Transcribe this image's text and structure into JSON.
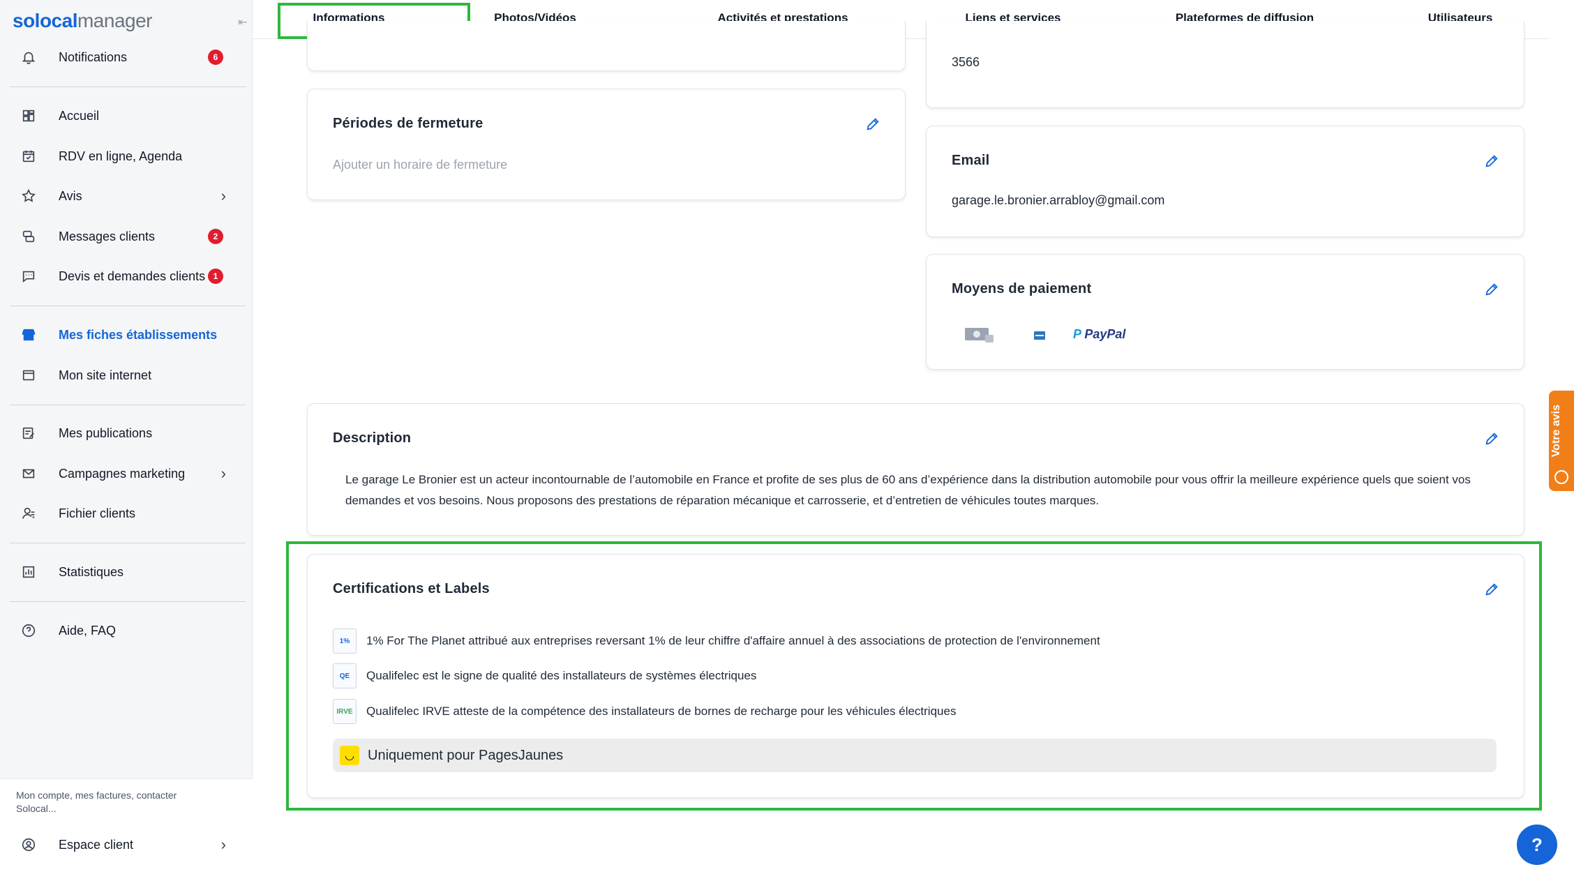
{
  "brand": {
    "logo_part1": "solocal",
    "logo_part2": "manager"
  },
  "sidebar": {
    "items": [
      {
        "label": "Notifications",
        "icon": "bell-icon",
        "badge": "6"
      },
      {
        "label": "Accueil",
        "icon": "dashboard-icon"
      },
      {
        "label": "RDV en ligne, Agenda",
        "icon": "calendar-icon"
      },
      {
        "label": "Avis",
        "icon": "star-icon"
      },
      {
        "label": "Messages clients",
        "icon": "messages-icon",
        "badge": "2"
      },
      {
        "label": "Devis et demandes clients",
        "icon": "chat-icon",
        "badge": "1"
      },
      {
        "label": "Mes fiches établissements",
        "icon": "store-icon"
      },
      {
        "label": "Mon site internet",
        "icon": "browser-icon"
      },
      {
        "label": "Mes publications",
        "icon": "publication-icon"
      },
      {
        "label": "Campagnes marketing",
        "icon": "mail-icon"
      },
      {
        "label": "Fichier clients",
        "icon": "users-icon"
      },
      {
        "label": "Statistiques",
        "icon": "stats-icon"
      },
      {
        "label": "Aide, FAQ",
        "icon": "help-icon"
      }
    ],
    "account_note": "Mon compte, mes factures, contacter Solocal...",
    "espace_client": "Espace client"
  },
  "tabs": [
    "Informations",
    "Photos/Vidéos",
    "Activités et prestations",
    "Liens et services",
    "Plateformes de diffusion",
    "Utilisateurs"
  ],
  "cards": {
    "top_right_value": "3566",
    "fermeture": {
      "title": "Périodes de fermeture",
      "placeholder": "Ajouter un horaire de fermeture"
    },
    "email": {
      "title": "Email",
      "value": "garage.le.bronier.arrabloy@gmail.com"
    },
    "paiement": {
      "title": "Moyens de paiement",
      "methods": [
        "cash-icon",
        "amex-icon"
      ],
      "paypal": "PayPal"
    },
    "description": {
      "title": "Description",
      "text": "Le garage Le Bronier est un acteur incontournable de l’automobile en France et profite de ses plus de 60 ans d’expérience dans la distribution automobile pour vous offrir la meilleure expérience quels que soient vos demandes et vos besoins. Nous proposons des prestations de réparation mécanique et carrosserie, et d’entretien de véhicules toutes marques."
    },
    "certifications": {
      "title": "Certifications et Labels",
      "items": [
        {
          "text": "1% For The Planet attribué aux entreprises reversant 1% de leur chiffre d'affaire annuel à des associations de protection de l'environnement",
          "logo": "1%"
        },
        {
          "text": "Qualifelec est le signe de qualité des installateurs de systèmes électriques",
          "logo": "QE"
        },
        {
          "text": "Qualifelec IRVE atteste de la compétence des installateurs de bornes de recharge pour les véhicules électriques",
          "logo": "IRVE"
        }
      ],
      "pagesjaunes": "Uniquement pour PagesJaunes"
    }
  },
  "feedback_tab": "Votre avis",
  "colors": {
    "accent": "#1565d8",
    "badge": "#e11d2e",
    "highlight": "#2db83d",
    "feedback": "#f07f1a"
  }
}
